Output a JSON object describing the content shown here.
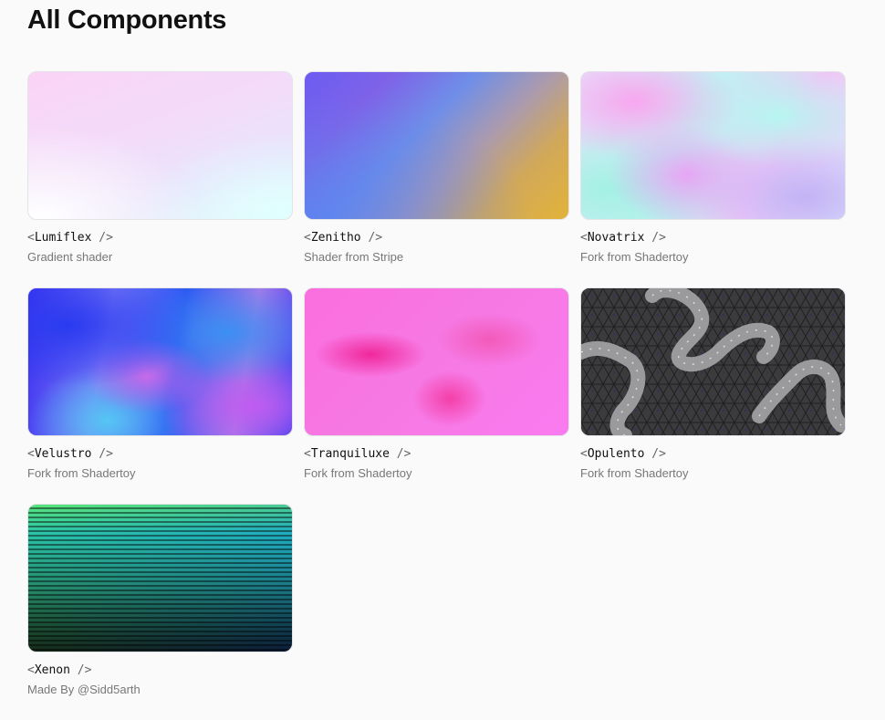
{
  "page": {
    "title": "All Components"
  },
  "components": [
    {
      "name": "Lumiflex",
      "description": "Gradient shader"
    },
    {
      "name": "Zenitho",
      "description": "Shader from Stripe"
    },
    {
      "name": "Novatrix",
      "description": "Fork from Shadertoy"
    },
    {
      "name": "Velustro",
      "description": "Fork from Shadertoy"
    },
    {
      "name": "Tranquiluxe",
      "description": "Fork from Shadertoy"
    },
    {
      "name": "Opulento",
      "description": "Fork from Shadertoy"
    },
    {
      "name": "Xenon",
      "description": "Made By @Sidd5arth"
    }
  ],
  "syntax": {
    "open": "<",
    "close": " />"
  }
}
